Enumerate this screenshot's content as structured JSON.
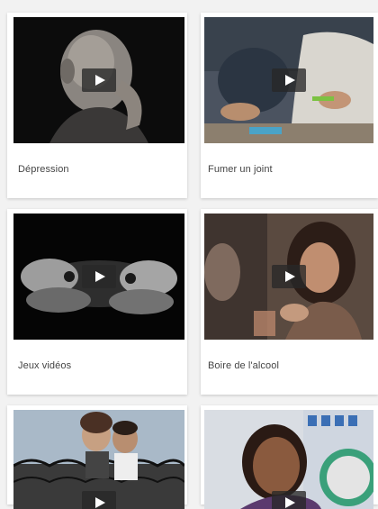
{
  "videos": [
    {
      "title": "Dépression",
      "icon": "play-icon"
    },
    {
      "title": "Fumer un joint",
      "icon": "play-icon"
    },
    {
      "title": "Jeux vidéos",
      "icon": "play-icon"
    },
    {
      "title": "Boire de l'alcool",
      "icon": "play-icon"
    },
    {
      "title": "",
      "icon": "play-icon"
    },
    {
      "title": "",
      "icon": "play-icon"
    }
  ],
  "colors": {
    "background": "#f2f2f2",
    "card": "#ffffff",
    "label": "#444444"
  }
}
